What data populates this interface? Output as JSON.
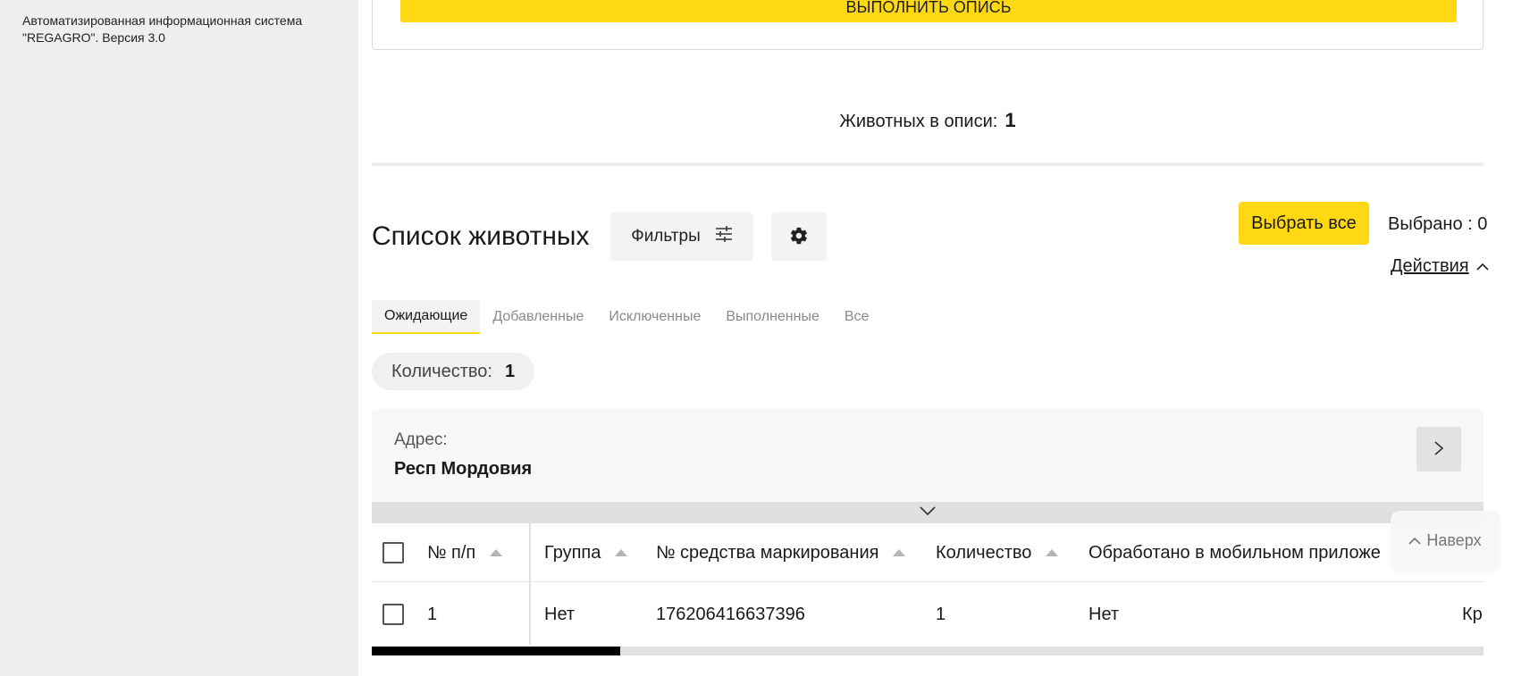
{
  "sidebar": {
    "system_name": "Автоматизированная информационная система \"REGAGRO\". Версия 3.0"
  },
  "execute": {
    "button_label": "Выполнить опись"
  },
  "inventory": {
    "label": "Животных в описи:",
    "count": "1"
  },
  "list": {
    "title": "Список животных",
    "filters_label": "Фильтры",
    "select_all_label": "Выбрать все",
    "selected_text": "Выбрано : 0",
    "actions_label": "Действия"
  },
  "tabs": [
    {
      "label": "Ожидающие",
      "active": true
    },
    {
      "label": "Добавленные",
      "active": false
    },
    {
      "label": "Исключенные",
      "active": false
    },
    {
      "label": "Выполненные",
      "active": false
    },
    {
      "label": "Все",
      "active": false
    }
  ],
  "quantity": {
    "label": "Количество:",
    "value": "1"
  },
  "address": {
    "label": "Адрес:",
    "value": "Респ Мордовия"
  },
  "table": {
    "columns": [
      "№ п/п",
      "Группа",
      "№ средства маркирования",
      "Количество",
      "Обработано в мобильном приложе"
    ],
    "rows": [
      {
        "num": "1",
        "group": "Нет",
        "marker": "176206416637396",
        "qty": "1",
        "mobile": "Нет",
        "extra": "Кр"
      }
    ],
    "scroll_position": 0.22
  },
  "to_top": {
    "label": "Наверх"
  },
  "colors": {
    "accent": "#ffd814",
    "sidebar_bg": "#efefef"
  }
}
